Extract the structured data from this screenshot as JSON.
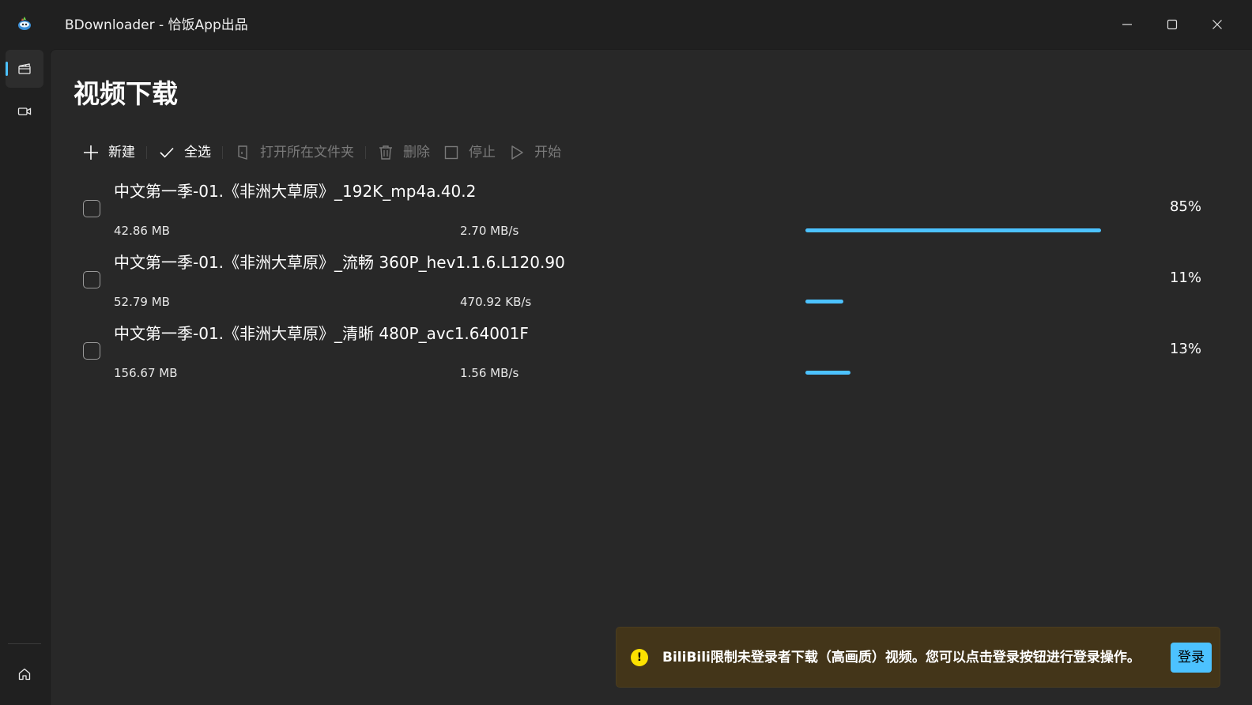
{
  "window": {
    "title": "BDownloader - 恰饭App出品",
    "icons": {
      "logo": "app-logo-icon",
      "minimize": "minimize-icon",
      "maximize": "maximize-icon",
      "close": "close-icon"
    }
  },
  "nav": {
    "items": [
      {
        "id": "download",
        "icon": "clapperboard-icon",
        "active": true
      },
      {
        "id": "video",
        "icon": "video-camera-icon",
        "active": false
      }
    ],
    "footer": {
      "icon": "home-icon"
    }
  },
  "page": {
    "title": "视频下载"
  },
  "toolbar": {
    "new_label": "新建",
    "select_all_label": "全选",
    "open_folder_label": "打开所在文件夹",
    "delete_label": "删除",
    "stop_label": "停止",
    "start_label": "开始"
  },
  "downloads": [
    {
      "title": "中文第一季-01.《非洲大草原》_192K_mp4a.40.2",
      "size": "42.86 MB",
      "speed": "2.70 MB/s",
      "progress": 0.85,
      "percent_text": "85%"
    },
    {
      "title": "中文第一季-01.《非洲大草原》_流畅 360P_hev1.1.6.L120.90",
      "size": "52.79 MB",
      "speed": "470.92 KB/s",
      "progress": 0.11,
      "percent_text": "11%"
    },
    {
      "title": "中文第一季-01.《非洲大草原》_清晰 480P_avc1.64001F",
      "size": "156.67 MB",
      "speed": "1.56 MB/s",
      "progress": 0.13,
      "percent_text": "13%"
    }
  ],
  "infobar": {
    "severity": "warning",
    "icon": "warning-icon",
    "icon_glyph": "!",
    "message": "BiliBili限制未登录者下载（高画质）视频。您可以点击登录按钮进行登录操作。",
    "action_label": "登录"
  },
  "colors": {
    "accent": "#4cc2ff",
    "warning_bg": "#433519",
    "warning_icon": "#fce100"
  }
}
